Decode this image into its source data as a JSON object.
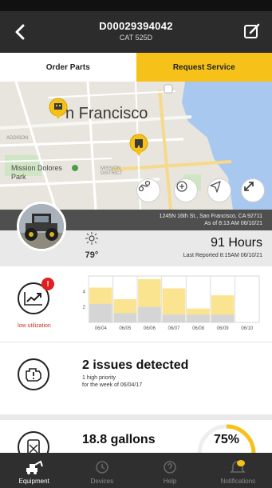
{
  "header": {
    "title": "D00029394042",
    "subtitle": "CAT 525D"
  },
  "tabs": [
    {
      "label": "Order Parts",
      "active": false
    },
    {
      "label": "Request Service",
      "active": true
    }
  ],
  "map": {
    "city_label": "n Francisco",
    "park_label": "Mission Dolores Park",
    "small_labels": [
      "ADDISON",
      "MISSION DISTRICT"
    ],
    "controls": [
      "route-icon",
      "service-icon",
      "navigate-icon",
      "expand-icon"
    ]
  },
  "location": {
    "address": "1245N 16th St., San Francisco, CA 92711",
    "as_of": "As of 8:13 AM 06/10/21"
  },
  "status": {
    "temperature": "79°",
    "hours": "91 Hours",
    "last_reported": "Last Reported 8:15AM 06/10/21"
  },
  "utilization": {
    "badge": "!",
    "label": "low utilization"
  },
  "chart_data": {
    "type": "bar",
    "categories": [
      "06/04",
      "06/05",
      "06/06",
      "06/07",
      "06/08",
      "06/09",
      "06/10"
    ],
    "series": [
      {
        "values": [
          4.5,
          3.0,
          5.6,
          4.4,
          1.8,
          3.5,
          0
        ]
      },
      {
        "values": [
          2.4,
          1.2,
          2.0,
          1.0,
          1.0,
          1.0,
          0
        ]
      }
    ],
    "yticks": [
      "4",
      "2"
    ],
    "ylim": [
      0,
      6
    ],
    "colors": [
      "#fbe48f",
      "#d5d5d5"
    ],
    "grid": true
  },
  "issues": {
    "title": "2 issues detected",
    "line1": "1 high priority",
    "line2": "for the week of 06/04/17"
  },
  "fuel": {
    "title": "18.8 gallons",
    "percent_text": "75%",
    "level": 0.75
  },
  "nav": [
    {
      "label": "Equipment",
      "icon": "excavator-icon",
      "active": true
    },
    {
      "label": "Devices",
      "icon": "device-icon",
      "active": false
    },
    {
      "label": "Help",
      "icon": "help-icon",
      "active": false
    },
    {
      "label": "Notifications",
      "icon": "bell-icon",
      "active": false
    }
  ],
  "colors": {
    "accent": "#f6c21a",
    "header": "#2c2c2c",
    "alert": "#e02020"
  }
}
